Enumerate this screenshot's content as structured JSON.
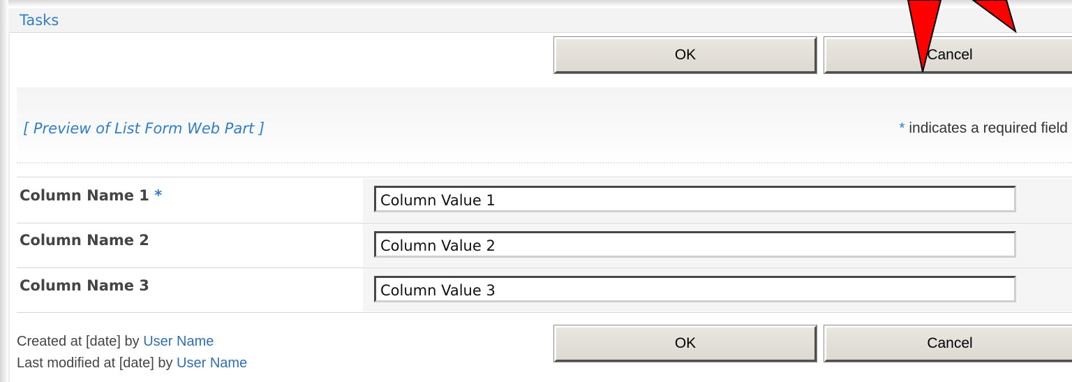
{
  "window": {
    "title": "Tasks"
  },
  "toolbar": {
    "ok_label": "OK",
    "cancel_label": "Cancel"
  },
  "preview": {
    "title": "[ Preview of List Form Web Part ]",
    "required_star": "*",
    "required_note": " indicates a required field"
  },
  "fields": [
    {
      "label": "Column Name 1",
      "required_mark": "*",
      "value": "Column Value 1"
    },
    {
      "label": "Column Name 2",
      "value": "Column Value 2"
    },
    {
      "label": "Column Name 3",
      "value": "Column Value 3"
    }
  ],
  "footer": {
    "created_prefix": "Created at [date] by ",
    "created_user": "User Name",
    "modified_prefix": "Last modified at [date] by ",
    "modified_user": "User Name",
    "ok_label": "OK",
    "cancel_label": "Cancel"
  },
  "colors": {
    "accent": "#2f7fc8",
    "annotation_arrow": "#ff0000"
  },
  "icons": [
    "annotation-arrow-icon"
  ]
}
